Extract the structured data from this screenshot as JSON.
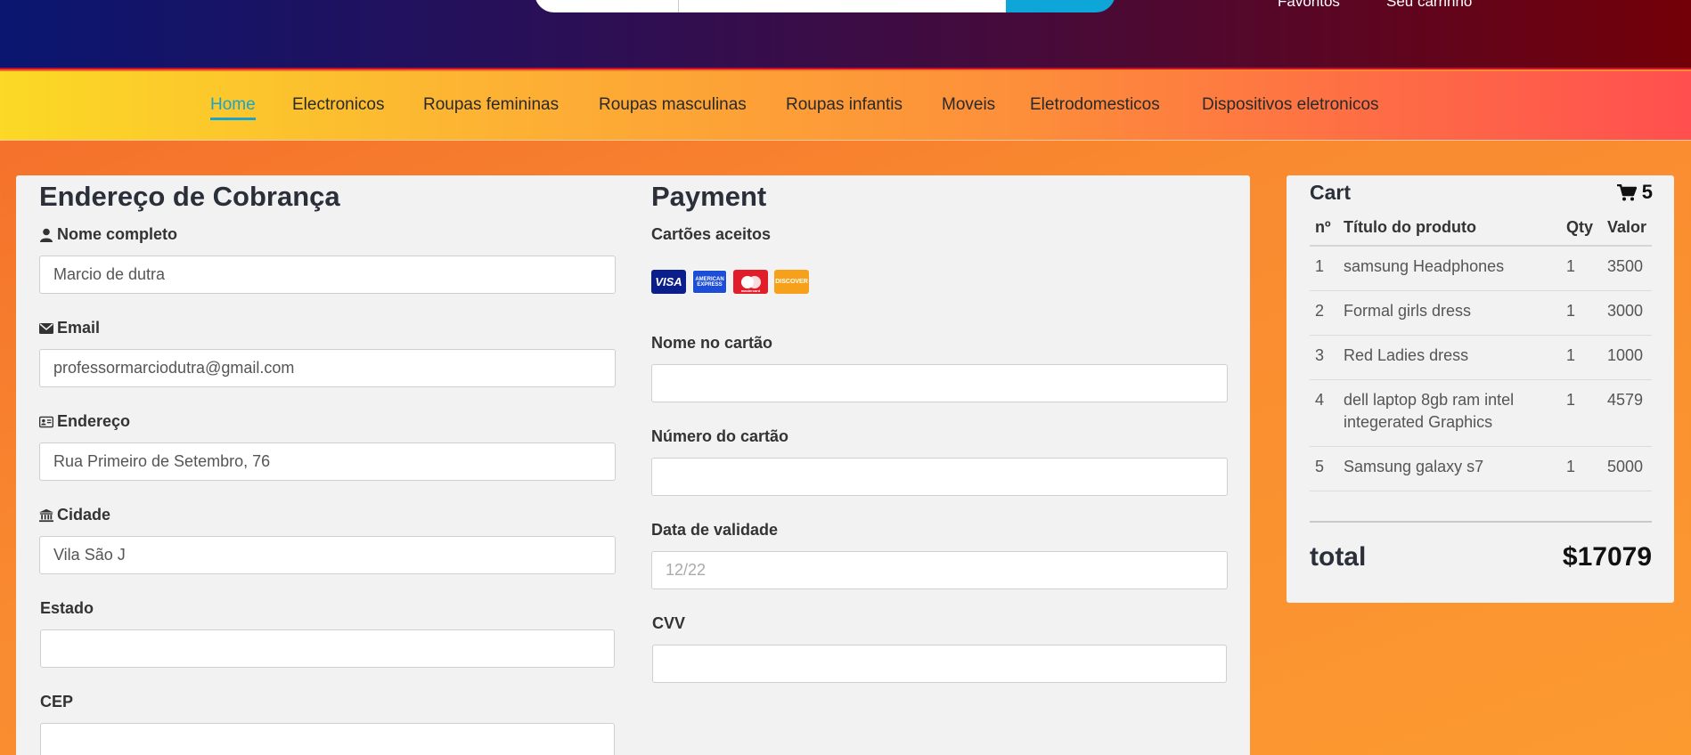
{
  "header": {
    "top_links": [
      "Favoritos",
      "Seu carrinho"
    ]
  },
  "nav": {
    "items": [
      "Home",
      "Electronicos",
      "Roupas femininas",
      "Roupas masculinas",
      "Roupas infantis",
      "Moveis",
      "Eletrodomesticos",
      "Dispositivos eletronicos"
    ]
  },
  "billing": {
    "title": "Endereço de Cobrança",
    "name_label": "Nome completo",
    "name_value": "Marcio de dutra",
    "email_label": "Email",
    "email_value": "professormarciodutra@gmail.com",
    "address_label": "Endereço",
    "address_value": "Rua Primeiro de Setembro, 76",
    "city_label": "Cidade",
    "city_value": "Vila São J",
    "state_label": "Estado",
    "state_value": "",
    "zip_label": "CEP",
    "zip_value": ""
  },
  "payment": {
    "title": "Payment",
    "accepted_label": "Cartões aceitos",
    "cards": [
      "VISA",
      "AMERICAN EXPRESS",
      "mastercard",
      "DISCOVER"
    ],
    "card_name_label": "Nome no cartão",
    "card_name_value": "",
    "card_number_label": "Número do cartão",
    "card_number_value": "",
    "expiry_label": "Data de validade",
    "expiry_placeholder": "12/22",
    "cvv_label": "CVV",
    "cvv_value": ""
  },
  "cart": {
    "title": "Cart",
    "count": "5",
    "headers": [
      "nº",
      "Título do produto",
      "Qty",
      "Valor"
    ],
    "rows": [
      {
        "n": "1",
        "title": "samsung Headphones",
        "qty": "1",
        "value": "3500"
      },
      {
        "n": "2",
        "title": "Formal girls dress",
        "qty": "1",
        "value": "3000"
      },
      {
        "n": "3",
        "title": "Red Ladies dress",
        "qty": "1",
        "value": "1000"
      },
      {
        "n": "4",
        "title": "dell laptop 8gb ram intel integerated Graphics",
        "qty": "1",
        "value": "4579"
      },
      {
        "n": "5",
        "title": "Samsung galaxy s7",
        "qty": "1",
        "value": "5000"
      }
    ],
    "total_label": "total",
    "total_value": "$17079"
  },
  "colors": {
    "accent": "#1aa5c8",
    "header_start": "#0a1670",
    "header_end": "#730008"
  }
}
